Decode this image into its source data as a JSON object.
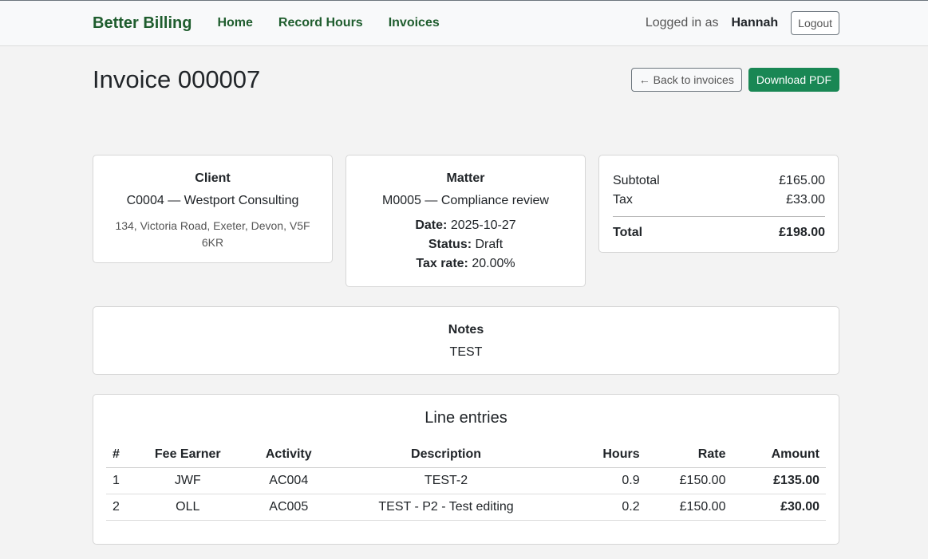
{
  "nav": {
    "brand": "Better Billing",
    "links": [
      "Home",
      "Record Hours",
      "Invoices"
    ],
    "logged_in_label": "Logged in as",
    "user": "Hannah",
    "logout": "Logout"
  },
  "header": {
    "title": "Invoice 000007",
    "back_button": "← Back to invoices",
    "download_button": "Download PDF"
  },
  "client": {
    "heading": "Client",
    "name": "C0004 — Westport Consulting",
    "address": "134, Victoria Road, Exeter, Devon, V5F 6KR"
  },
  "matter": {
    "heading": "Matter",
    "name": "M0005 — Compliance review",
    "date_label": "Date:",
    "date": "2025-10-27",
    "status_label": "Status:",
    "status": "Draft",
    "tax_rate_label": "Tax rate:",
    "tax_rate": "20.00%"
  },
  "totals": {
    "subtotal_label": "Subtotal",
    "subtotal": "£165.00",
    "tax_label": "Tax",
    "tax": "£33.00",
    "total_label": "Total",
    "total": "£198.00"
  },
  "notes": {
    "heading": "Notes",
    "text": "TEST"
  },
  "lines": {
    "heading": "Line entries",
    "columns": [
      "#",
      "Fee Earner",
      "Activity",
      "Description",
      "Hours",
      "Rate",
      "Amount"
    ],
    "rows": [
      [
        "1",
        "JWF",
        "AC004",
        "TEST-2",
        "0.9",
        "£150.00",
        "£135.00"
      ],
      [
        "2",
        "OLL",
        "AC005",
        "TEST - P2 - Test editing",
        "0.2",
        "£150.00",
        "£30.00"
      ]
    ]
  }
}
